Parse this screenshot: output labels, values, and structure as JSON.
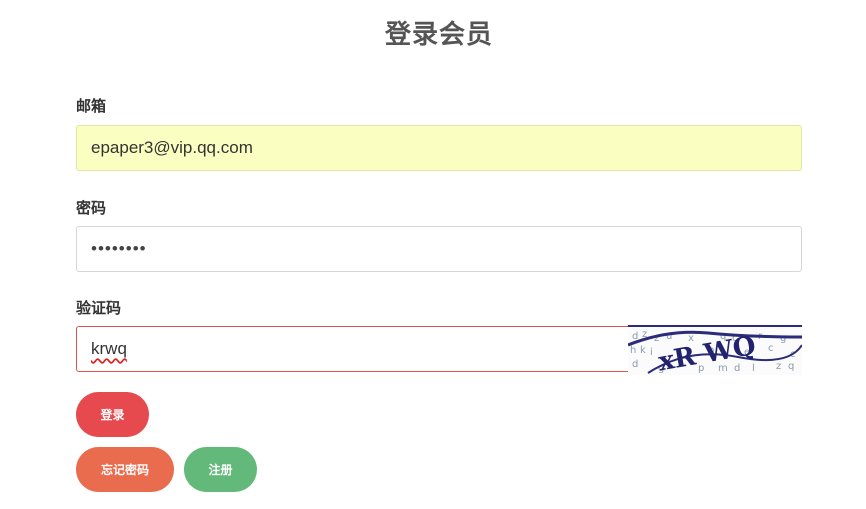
{
  "page": {
    "title": "登录会员"
  },
  "form": {
    "email_label": "邮箱",
    "email_value": "epaper3@vip.qq.com",
    "password_label": "密码",
    "password_value": "••••••••",
    "captcha_label": "验证码",
    "captcha_value": "krwq",
    "captcha_image_text": "xR WQ"
  },
  "buttons": {
    "login": "登录",
    "forgot_password": "忘记密码",
    "register": "注册"
  },
  "colors": {
    "login_button": "#e64a4f",
    "forgot_button": "#e86c4d",
    "register_button": "#62b979",
    "autofill_background": "#fafec0",
    "error_border": "#d9534f"
  }
}
